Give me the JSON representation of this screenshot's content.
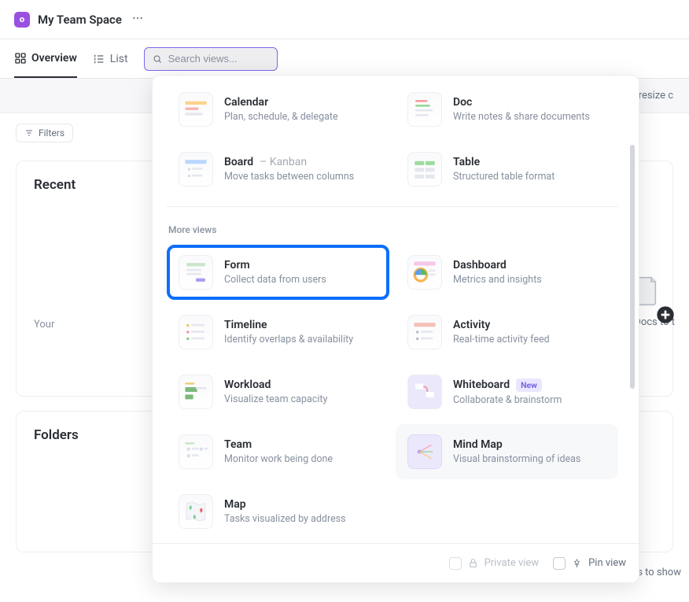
{
  "header": {
    "space_title": "My Team Space"
  },
  "tabs": {
    "overview": "Overview",
    "list": "List"
  },
  "search": {
    "placeholder": "Search views..."
  },
  "banner": {
    "text_fragment": "nd resize c"
  },
  "filters": {
    "label": "Filters"
  },
  "sections": {
    "recent": "Recent",
    "folders": "Folders",
    "recent_sub": "Your",
    "docs_fragment": "ny Docs to t",
    "footer_fragment": "ers to show"
  },
  "popup": {
    "section_more": "More views",
    "views": {
      "calendar": {
        "title": "Calendar",
        "desc": "Plan, schedule, & delegate"
      },
      "doc": {
        "title": "Doc",
        "desc": "Write notes & share documents"
      },
      "board": {
        "title": "Board",
        "suffix": "– Kanban",
        "desc": "Move tasks between columns"
      },
      "table": {
        "title": "Table",
        "desc": "Structured table format"
      },
      "form": {
        "title": "Form",
        "desc": "Collect data from users"
      },
      "dashboard": {
        "title": "Dashboard",
        "desc": "Metrics and insights"
      },
      "timeline": {
        "title": "Timeline",
        "desc": "Identify overlaps & availability"
      },
      "activity": {
        "title": "Activity",
        "desc": "Real-time activity feed"
      },
      "workload": {
        "title": "Workload",
        "desc": "Visualize team capacity"
      },
      "whiteboard": {
        "title": "Whiteboard",
        "badge": "New",
        "desc": "Collaborate & brainstorm"
      },
      "team": {
        "title": "Team",
        "desc": "Monitor work being done"
      },
      "mindmap": {
        "title": "Mind Map",
        "desc": "Visual brainstorming of ideas"
      },
      "map": {
        "title": "Map",
        "desc": "Tasks visualized by address"
      }
    },
    "footer": {
      "private": "Private view",
      "pin": "Pin view"
    }
  }
}
